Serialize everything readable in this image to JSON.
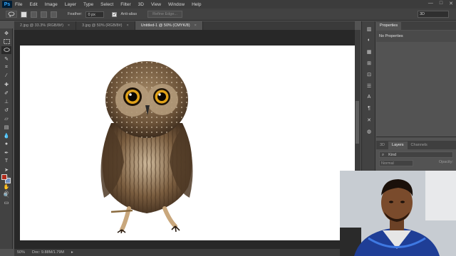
{
  "app": {
    "logo": "Ps",
    "menu": [
      "File",
      "Edit",
      "Image",
      "Layer",
      "Type",
      "Select",
      "Filter",
      "3D",
      "View",
      "Window",
      "Help"
    ],
    "window_controls": [
      "—",
      "□",
      "✕"
    ]
  },
  "options": {
    "feather_label": "Feather:",
    "feather_value": "0 px",
    "antialias_label": "Anti-alias",
    "antialias_checked": true,
    "refine_edge_label": "Refine Edge...",
    "workspace": "3D"
  },
  "tabs": [
    {
      "label": "2.jpg @ 33.3% (RGB/8#)",
      "close": "×",
      "active": false
    },
    {
      "label": "3.jpg @ 50% (RGB/8#)",
      "close": "×",
      "active": false
    },
    {
      "label": "Untitled-1 @ 50% (CMYK/8)",
      "close": "×",
      "active": true
    }
  ],
  "colors": {
    "foreground": "#b22b1c",
    "background": "#6f8fbe",
    "accent": "#31a8ff"
  },
  "tools": [
    "move-tool",
    "marquee-tool",
    "lasso-tool",
    "quick-select-tool",
    "crop-tool",
    "eyedropper-tool",
    "healing-brush-tool",
    "brush-tool",
    "clone-stamp-tool",
    "history-brush-tool",
    "eraser-tool",
    "gradient-tool",
    "blur-tool",
    "dodge-tool",
    "pen-tool",
    "type-tool",
    "path-select-tool",
    "rectangle-tool",
    "hand-tool",
    "zoom-tool",
    "more-tools"
  ],
  "status": {
    "zoom": "50%",
    "doc_info": "Doc: 9.88M/1.79M",
    "arrow": "▸"
  },
  "properties_panel": {
    "tab": "Properties",
    "message": "No Properties"
  },
  "layers_panel": {
    "tabs": [
      "3D",
      "Layers",
      "Channels"
    ],
    "filter_kind": "Kind",
    "blend_mode": "Normal",
    "opacity_label": "Opacity:"
  }
}
